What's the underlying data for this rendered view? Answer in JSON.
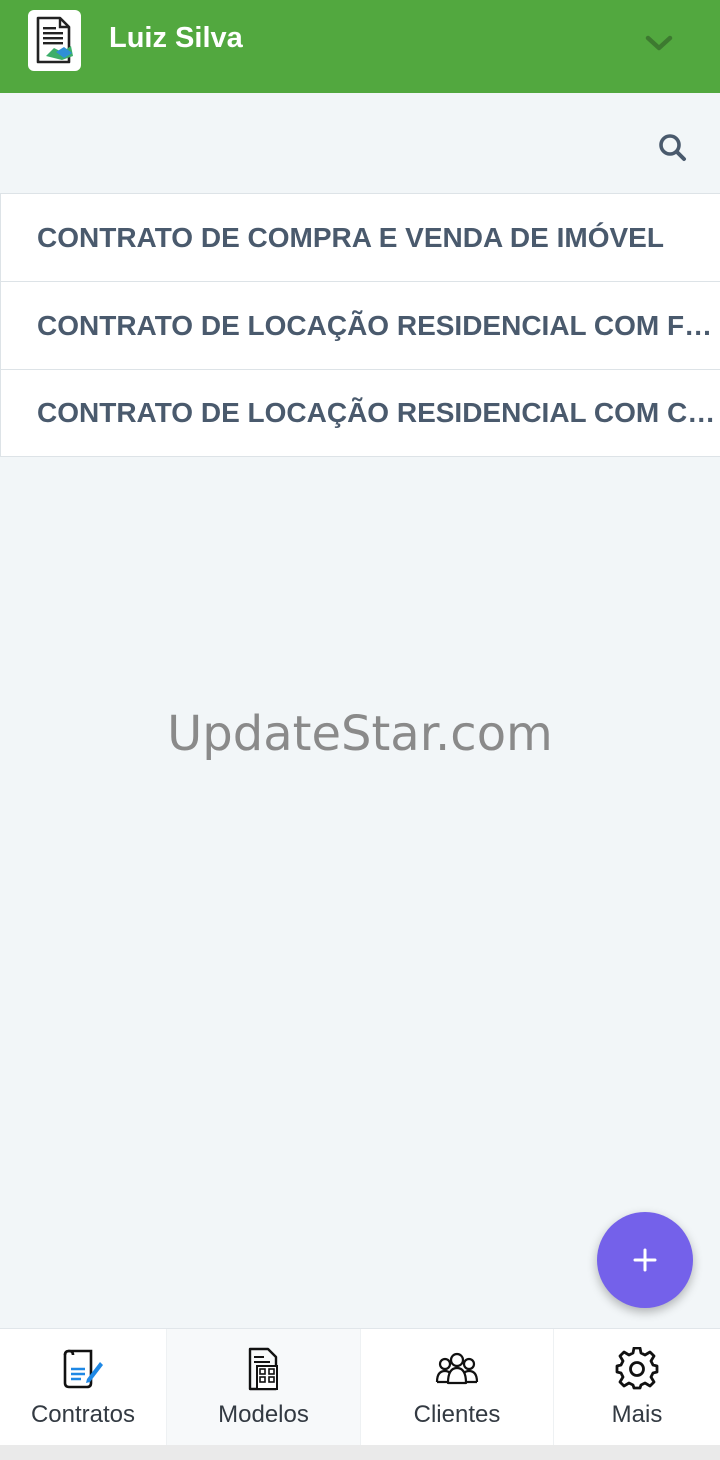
{
  "header": {
    "title": "Luiz Silva",
    "background_color": "#52a83f",
    "logo_icon": "contract-document-icon",
    "menu_icon": "chevron-down-icon"
  },
  "toolbar": {
    "search_icon": "search-icon"
  },
  "contracts": [
    {
      "title": "CONTRATO DE COMPRA E VENDA DE IMÓVEL"
    },
    {
      "title": "CONTRATO DE LOCAÇÃO RESIDENCIAL COM FIADOR"
    },
    {
      "title": "CONTRATO DE LOCAÇÃO RESIDENCIAL COM CAUÇÃO"
    }
  ],
  "watermark": "UpdateStar.com",
  "fab": {
    "icon": "plus-icon",
    "color": "#7461ea"
  },
  "bottom_nav": [
    {
      "label": "Contratos",
      "icon": "contract-edit-icon"
    },
    {
      "label": "Modelos",
      "icon": "document-grid-icon",
      "active": true
    },
    {
      "label": "Clientes",
      "icon": "people-group-icon"
    },
    {
      "label": "Mais",
      "icon": "gear-icon"
    }
  ]
}
